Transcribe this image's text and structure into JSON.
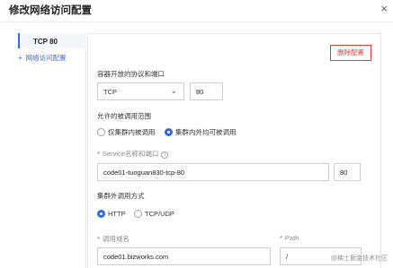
{
  "dialog": {
    "title": "修改网络访问配置",
    "close_label": "×"
  },
  "sidebar": {
    "active_label": "TCP 80",
    "add_item": {
      "icon": "plus-icon",
      "plus": "+",
      "label": "网络访问配置"
    }
  },
  "form": {
    "delete_label": "删除配置",
    "protocol_port": {
      "label": "容器开放的协议和端口",
      "protocol_value": "TCP",
      "port_value": "80"
    },
    "scope": {
      "label": "允许的被调用范围",
      "options": [
        {
          "label": "仅集群内被调用",
          "selected": false
        },
        {
          "label": "集群内外均可被调用",
          "selected": true
        }
      ]
    },
    "service": {
      "required_mark": "*",
      "label": "Service名称和端口",
      "name_value": "code01-tuoguan830-tcp-80",
      "port_value": "80"
    },
    "external": {
      "label": "集群外调用方式",
      "options": [
        {
          "label": "HTTP",
          "selected": true
        },
        {
          "label": "TCP/UDP",
          "selected": false
        }
      ]
    },
    "domain": {
      "required_mark": "*",
      "label": "调用域名",
      "value": "code01.bizworks.com"
    },
    "path": {
      "required_mark": "*",
      "label": "Path",
      "value": "/"
    }
  },
  "watermark": "@稀土掘金技术社区",
  "colors": {
    "accent": "#2f6ae6",
    "danger": "#e43a38"
  }
}
